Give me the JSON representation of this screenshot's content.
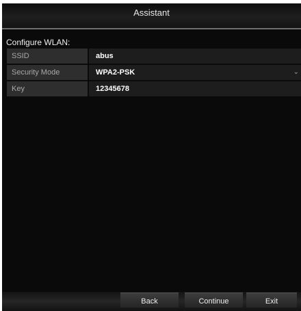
{
  "window": {
    "title": "Assistant"
  },
  "section": {
    "title": "Configure WLAN:"
  },
  "fields": [
    {
      "label": "SSID",
      "value": "abus"
    },
    {
      "label": "Security Mode",
      "value": "WPA2-PSK",
      "has_dropdown": true
    },
    {
      "label": "Key",
      "value": "12345678"
    }
  ],
  "icons": {
    "dropdown": "chevron-down-icon"
  },
  "buttons": {
    "back": "Back",
    "continue": "Continue",
    "exit": "Exit"
  }
}
